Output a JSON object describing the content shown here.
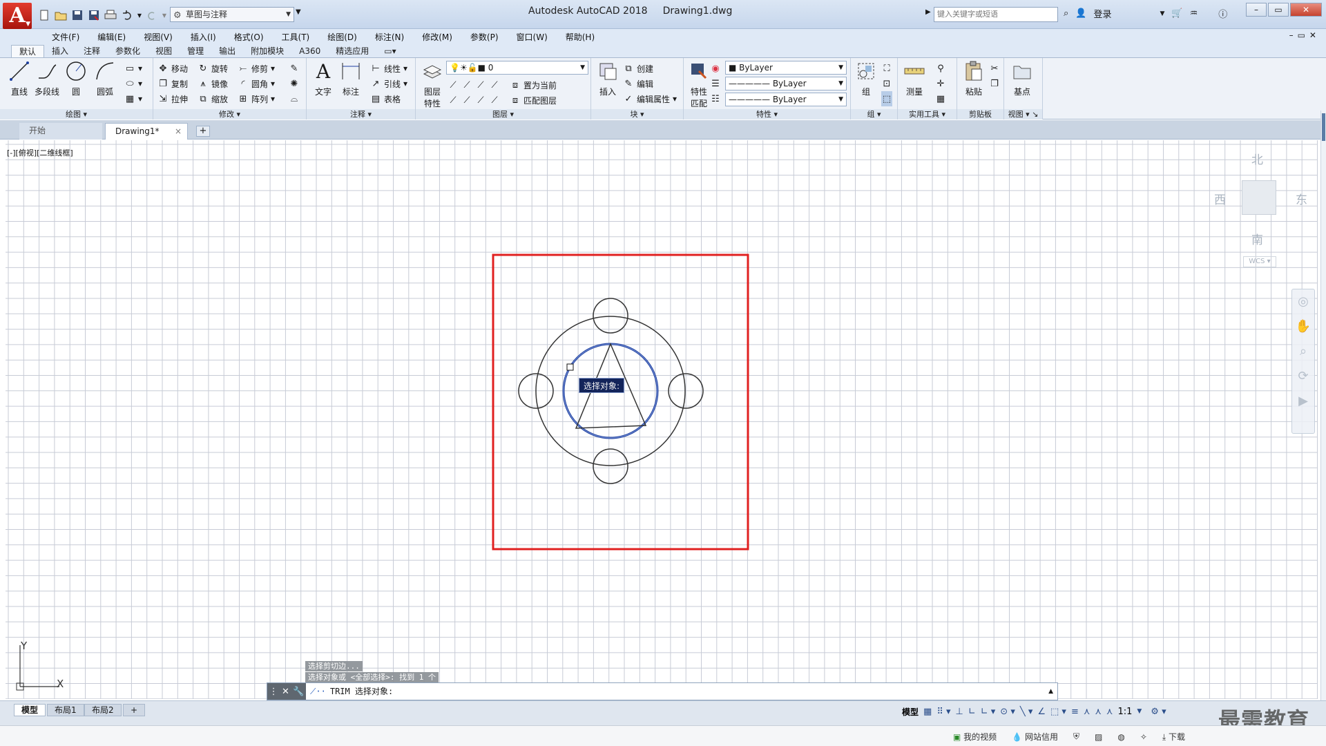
{
  "titlebar": {
    "app_logo": "A",
    "workspace": "草图与注释",
    "app_name": "Autodesk AutoCAD 2018",
    "file_name": "Drawing1.dwg",
    "search_placeholder": "键入关键字或短语",
    "login": "登录"
  },
  "menu": [
    "文件(F)",
    "编辑(E)",
    "视图(V)",
    "插入(I)",
    "格式(O)",
    "工具(T)",
    "绘图(D)",
    "标注(N)",
    "修改(M)",
    "参数(P)",
    "窗口(W)",
    "帮助(H)"
  ],
  "ribbon_tabs": [
    "默认",
    "插入",
    "注释",
    "参数化",
    "视图",
    "管理",
    "输出",
    "附加模块",
    "A360",
    "精选应用"
  ],
  "panels": {
    "draw": {
      "title": "绘图",
      "line": "直线",
      "polyline": "多段线",
      "circle": "圆",
      "arc": "圆弧"
    },
    "modify": {
      "title": "修改",
      "move": "移动",
      "rotate": "旋转",
      "trim": "修剪",
      "copy": "复制",
      "mirror": "镜像",
      "fillet": "圆角",
      "stretch": "拉伸",
      "scale": "缩放",
      "array": "阵列"
    },
    "annotation": {
      "title": "注释",
      "text": "文字",
      "dimension": "标注",
      "linear": "线性",
      "leader": "引线",
      "table": "表格"
    },
    "layers": {
      "title": "图层",
      "properties_line1": "图层",
      "properties_line2": "特性",
      "current_layer": "0",
      "make_current": "置为当前",
      "match_layer": "匹配图层"
    },
    "block": {
      "title": "块",
      "insert": "插入",
      "create": "创建",
      "edit": "编辑",
      "edit_attributes": "编辑属性"
    },
    "properties": {
      "title": "特性",
      "match_line1": "特性",
      "match_line2": "匹配",
      "color": "ByLayer",
      "lineweight": "ByLayer",
      "linetype": "ByLayer"
    },
    "groups": {
      "title": "组",
      "group": "组"
    },
    "utilities": {
      "title": "实用工具",
      "measure": "测量"
    },
    "clipboard": {
      "title": "剪贴板",
      "paste": "粘贴"
    },
    "view": {
      "title": "视图",
      "base": "基点"
    }
  },
  "doc_tabs": {
    "start": "开始",
    "drawing": "Drawing1*",
    "close": "×",
    "add": "+"
  },
  "viewport_label": "[-][俯视][二维线框]",
  "viewcube": {
    "north": "北",
    "south": "南",
    "east": "东",
    "west": "西",
    "wcs": "WCS"
  },
  "ucs": {
    "x": "X",
    "y": "Y"
  },
  "tooltip": "选择对象:",
  "command": {
    "history": [
      "选择剪切边...",
      "选择对象或 <全部选择>:  找到 1 个"
    ],
    "current": "TRIM 选择对象:"
  },
  "layout_tabs": [
    "模型",
    "布局1",
    "布局2"
  ],
  "status": {
    "model": "模型",
    "scale": "1:1"
  },
  "bottom": {
    "video": "我的视频",
    "credit": "网站信用",
    "download": "下载"
  },
  "watermark": "最需教育",
  "colors": {
    "selection_circle": "#1d3fa0",
    "highlight_rect": "#e02020",
    "grid": "#c7cbd6"
  }
}
